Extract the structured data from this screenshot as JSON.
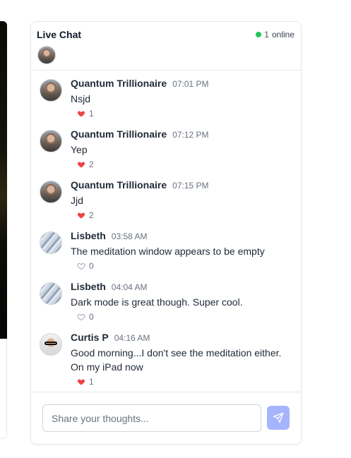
{
  "chat": {
    "title": "Live Chat",
    "online_count": "1",
    "online_label": "online",
    "input_placeholder": "Share your thoughts...",
    "send_icon": "paper-plane-icon",
    "colors": {
      "accent": "#a5b4fc",
      "online": "#22c55e",
      "liked": "#ef4444",
      "unliked": "#9ca3af"
    }
  },
  "messages": [
    {
      "name": "Quantum Trillionaire",
      "time": "07:01 PM",
      "text": "Nsjd",
      "likes": "1",
      "liked": true,
      "avatar": "quantum"
    },
    {
      "name": "Quantum Trillionaire",
      "time": "07:12 PM",
      "text": "Yep",
      "likes": "2",
      "liked": true,
      "avatar": "quantum"
    },
    {
      "name": "Quantum Trillionaire",
      "time": "07:15 PM",
      "text": "Jjd",
      "likes": "2",
      "liked": true,
      "avatar": "quantum"
    },
    {
      "name": "Lisbeth",
      "time": "03:58 AM",
      "text": "The meditation window appears to be empty",
      "likes": "0",
      "liked": false,
      "avatar": "lisbeth"
    },
    {
      "name": "Lisbeth",
      "time": "04:04 AM",
      "text": "Dark mode is great though. Super cool.",
      "likes": "0",
      "liked": false,
      "avatar": "lisbeth"
    },
    {
      "name": "Curtis P",
      "time": "04:16 AM",
      "text": "Good morning...I don't see the meditation either. On my iPad now",
      "likes": "1",
      "liked": true,
      "avatar": "curtis"
    }
  ]
}
